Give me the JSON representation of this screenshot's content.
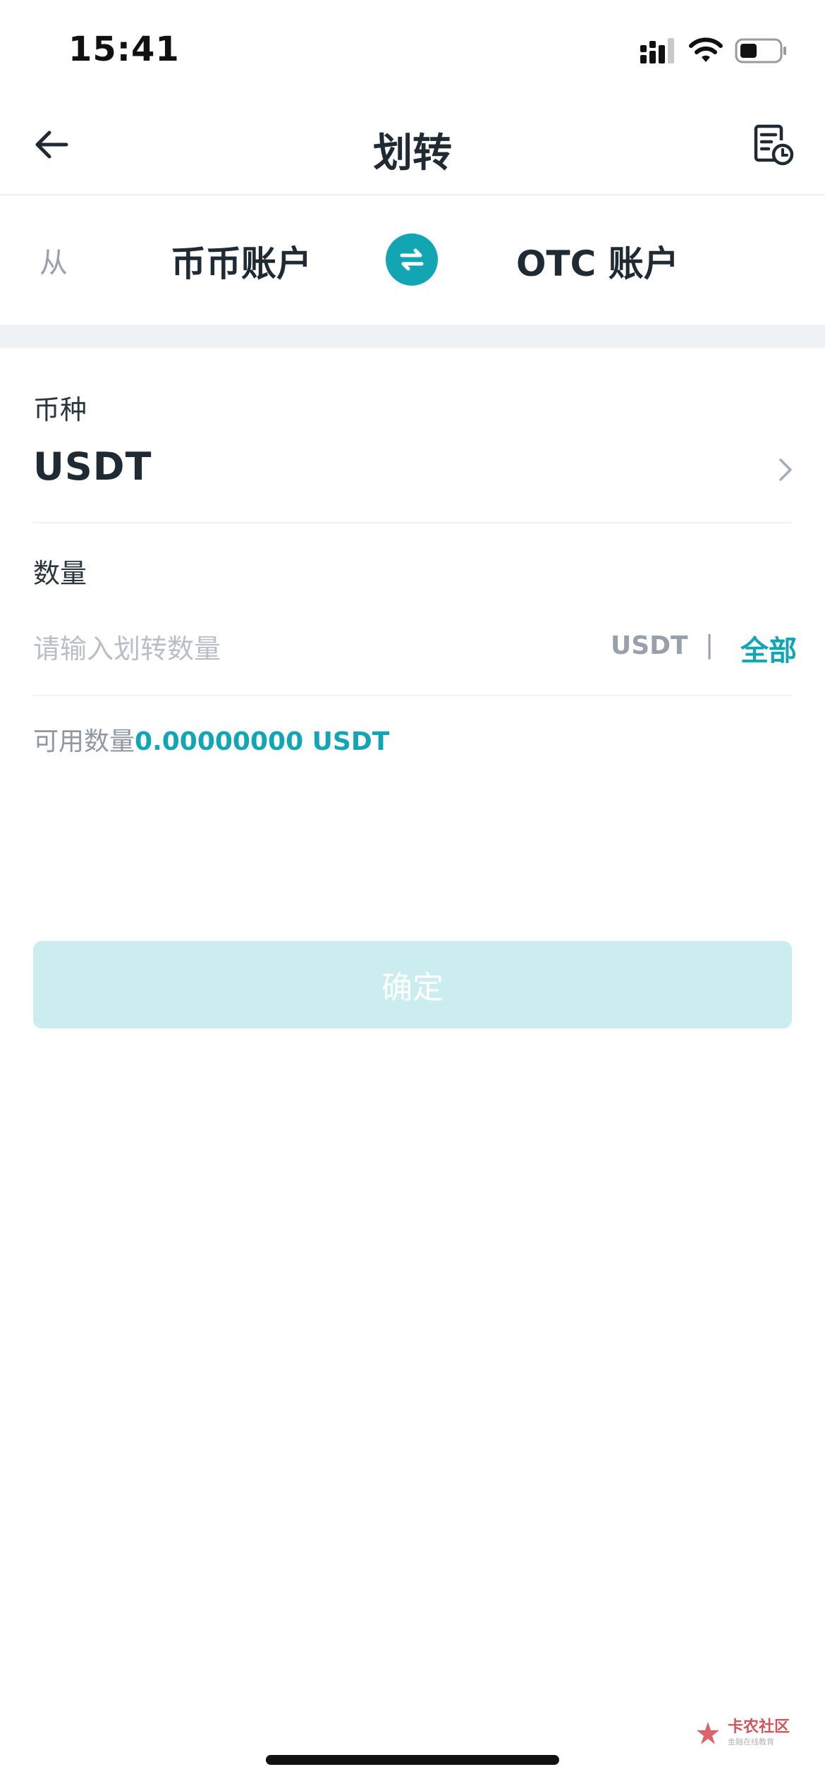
{
  "status_bar": {
    "time": "15:41",
    "battery_level": 0.45
  },
  "nav": {
    "title": "划转",
    "back_icon": "arrow-left-icon",
    "record_icon": "transfer-record-icon"
  },
  "transfer": {
    "from_label": "从",
    "from_account": "币币账户",
    "to_account": "OTC 账户",
    "swap_icon": "swap-arrows-icon"
  },
  "coin": {
    "label": "币种",
    "value": "USDT"
  },
  "quantity": {
    "label": "数量",
    "placeholder": "请输入划转数量",
    "unit": "USDT",
    "separator": "|",
    "all_label": "全部"
  },
  "available": {
    "label": "可用数量",
    "value": "0.00000000 USDT"
  },
  "confirm": {
    "label": "确定"
  },
  "watermark": {
    "title": "卡农社区",
    "subtitle": "金融在线教育"
  },
  "colors": {
    "accent": "#12a6b5",
    "disabled_button": "#cbedf0",
    "section_gap": "#eff2f5"
  }
}
